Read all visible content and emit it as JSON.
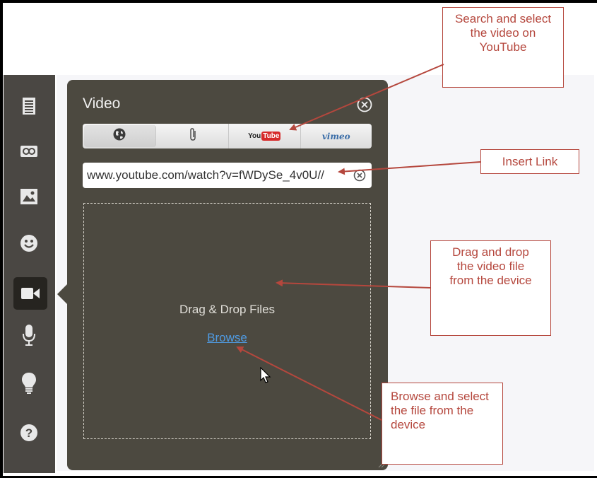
{
  "panel": {
    "title": "Video",
    "tabs": [
      {
        "name": "web-link",
        "label": ""
      },
      {
        "name": "attachment",
        "label": ""
      },
      {
        "name": "youtube",
        "label_you": "You",
        "label_tube": "Tube"
      },
      {
        "name": "vimeo",
        "label": "vimeo"
      }
    ],
    "url_value": "//www.youtube.com/watch?v=fWDySe_4v0U",
    "drop_text": "Drag & Drop Files",
    "browse_label": "Browse"
  },
  "sidebar": {
    "items": [
      "document-icon",
      "link-icon",
      "image-icon",
      "smiley-icon",
      "video-camera-icon",
      "microphone-icon",
      "lightbulb-icon",
      "help-icon"
    ],
    "active": "video-camera-icon"
  },
  "callouts": {
    "search": "Search and select the video on YouTube",
    "insert": "Insert Link",
    "drag": "Drag and drop the video file from the device",
    "browse": "Browse and select the file from the device"
  },
  "colors": {
    "annotation": "#b5473d",
    "panel": "#4c4940",
    "sidebar": "#4a4743",
    "link": "#4f9be3"
  }
}
